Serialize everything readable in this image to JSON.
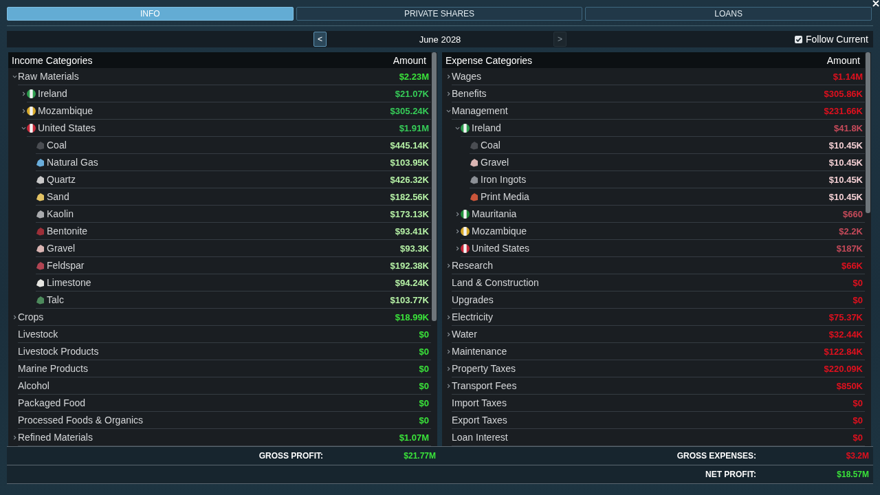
{
  "tabs": [
    {
      "label": "INFO",
      "selected": true
    },
    {
      "label": "PRIVATE SHARES",
      "selected": false
    },
    {
      "label": "LOANS",
      "selected": false
    }
  ],
  "period": {
    "previous": {
      "label": "<",
      "disabled": false
    },
    "label": "June 2028",
    "next": {
      "label": ">",
      "disabled": true
    }
  },
  "follow_current": {
    "label": "Follow Current",
    "checked": true
  },
  "tables": [
    {
      "kind": "income",
      "columns": [
        "Income Categories",
        "Amount"
      ],
      "rows": [
        {
          "name": "Raw Materials",
          "kind": "group",
          "expanded": true,
          "amount": "$2.23M",
          "children": [
            {
              "name": "Ireland",
              "kind": "country",
              "color": "#2e9e4f",
              "expanded": false,
              "amount": "$21.07K"
            },
            {
              "name": "Mozambique",
              "kind": "country",
              "color": "#d9aa2a",
              "expanded": false,
              "amount": "$305.24K"
            },
            {
              "name": "United States",
              "kind": "country",
              "color": "#c8283a",
              "expanded": true,
              "amount": "$1.91M",
              "children": [
                {
                  "name": "Coal",
                  "kind": "resource",
                  "color": "#4a4d52",
                  "amount": "$445.14K"
                },
                {
                  "name": "Natural Gas",
                  "kind": "resource",
                  "color": "#6aaedc",
                  "amount": "$103.95K"
                },
                {
                  "name": "Quartz",
                  "kind": "resource",
                  "color": "#c9c9c9",
                  "amount": "$426.32K"
                },
                {
                  "name": "Sand",
                  "kind": "resource",
                  "color": "#e2c263",
                  "amount": "$182.56K"
                },
                {
                  "name": "Kaolin",
                  "kind": "resource",
                  "color": "#a9abae",
                  "amount": "$173.13K"
                },
                {
                  "name": "Bentonite",
                  "kind": "resource",
                  "color": "#9c2f38",
                  "amount": "$93.41K"
                },
                {
                  "name": "Gravel",
                  "kind": "resource",
                  "color": "#d9b4b2",
                  "amount": "$93.3K"
                },
                {
                  "name": "Feldspar",
                  "kind": "resource",
                  "color": "#b04452",
                  "amount": "$192.38K"
                },
                {
                  "name": "Limestone",
                  "kind": "resource",
                  "color": "#e6e6e2",
                  "amount": "$94.24K"
                },
                {
                  "name": "Talc",
                  "kind": "resource",
                  "color": "#4d8a5c",
                  "amount": "$103.77K"
                }
              ]
            }
          ]
        },
        {
          "name": "Crops",
          "kind": "group",
          "expanded": false,
          "amount": "$18.99K"
        },
        {
          "name": "Livestock",
          "kind": "category",
          "amount": "$0"
        },
        {
          "name": "Livestock Products",
          "kind": "category",
          "amount": "$0"
        },
        {
          "name": "Marine Products",
          "kind": "category",
          "amount": "$0"
        },
        {
          "name": "Alcohol",
          "kind": "category",
          "amount": "$0"
        },
        {
          "name": "Packaged Food",
          "kind": "category",
          "amount": "$0"
        },
        {
          "name": "Processed Foods & Organics",
          "kind": "category",
          "amount": "$0"
        },
        {
          "name": "Refined Materials",
          "kind": "group",
          "expanded": false,
          "amount": "$1.07M"
        }
      ]
    },
    {
      "kind": "expense",
      "columns": [
        "Expense Categories",
        "Amount"
      ],
      "rows": [
        {
          "name": "Wages",
          "kind": "group",
          "expanded": false,
          "amount": "$1.14M"
        },
        {
          "name": "Benefits",
          "kind": "group",
          "expanded": false,
          "amount": "$305.86K"
        },
        {
          "name": "Management",
          "kind": "group",
          "expanded": true,
          "amount": "$231.66K",
          "children": [
            {
              "name": "Ireland",
              "kind": "country",
              "color": "#2e9e4f",
              "expanded": true,
              "amount": "$41.8K",
              "children": [
                {
                  "name": "Coal",
                  "kind": "resource",
                  "color": "#4a4d52",
                  "amount": "$10.45K"
                },
                {
                  "name": "Gravel",
                  "kind": "resource",
                  "color": "#d9b4b2",
                  "amount": "$10.45K"
                },
                {
                  "name": "Iron Ingots",
                  "kind": "resource",
                  "color": "#8c9096",
                  "amount": "$10.45K"
                },
                {
                  "name": "Print Media",
                  "kind": "resource",
                  "color": "#c9553a",
                  "amount": "$10.45K"
                }
              ]
            },
            {
              "name": "Mauritania",
              "kind": "country",
              "color": "#1f8f3a",
              "expanded": false,
              "amount": "$660"
            },
            {
              "name": "Mozambique",
              "kind": "country",
              "color": "#d9aa2a",
              "expanded": false,
              "amount": "$2.2K"
            },
            {
              "name": "United States",
              "kind": "country",
              "color": "#c8283a",
              "expanded": false,
              "amount": "$187K"
            }
          ]
        },
        {
          "name": "Research",
          "kind": "group",
          "expanded": false,
          "amount": "$66K"
        },
        {
          "name": "Land & Construction",
          "kind": "category",
          "amount": "$0"
        },
        {
          "name": "Upgrades",
          "kind": "category",
          "amount": "$0"
        },
        {
          "name": "Electricity",
          "kind": "group",
          "expanded": false,
          "amount": "$75.37K"
        },
        {
          "name": "Water",
          "kind": "group",
          "expanded": false,
          "amount": "$32.44K"
        },
        {
          "name": "Maintenance",
          "kind": "group",
          "expanded": false,
          "amount": "$122.84K"
        },
        {
          "name": "Property Taxes",
          "kind": "group",
          "expanded": false,
          "amount": "$220.09K"
        },
        {
          "name": "Transport Fees",
          "kind": "group",
          "expanded": false,
          "amount": "$850K"
        },
        {
          "name": "Import Taxes",
          "kind": "category",
          "amount": "$0"
        },
        {
          "name": "Export Taxes",
          "kind": "category",
          "amount": "$0"
        },
        {
          "name": "Loan Interest",
          "kind": "category",
          "amount": "$0"
        }
      ]
    }
  ],
  "summary": {
    "gross_profit": {
      "label": "GROSS PROFIT:",
      "value": "$21.77M",
      "kind": "positive"
    },
    "gross_expenses": {
      "label": "GROSS EXPENSES:",
      "value": "$3.2M",
      "kind": "negative"
    },
    "net_profit": {
      "label": "NET PROFIT:",
      "value": "$18.57M",
      "kind": "positive"
    }
  }
}
